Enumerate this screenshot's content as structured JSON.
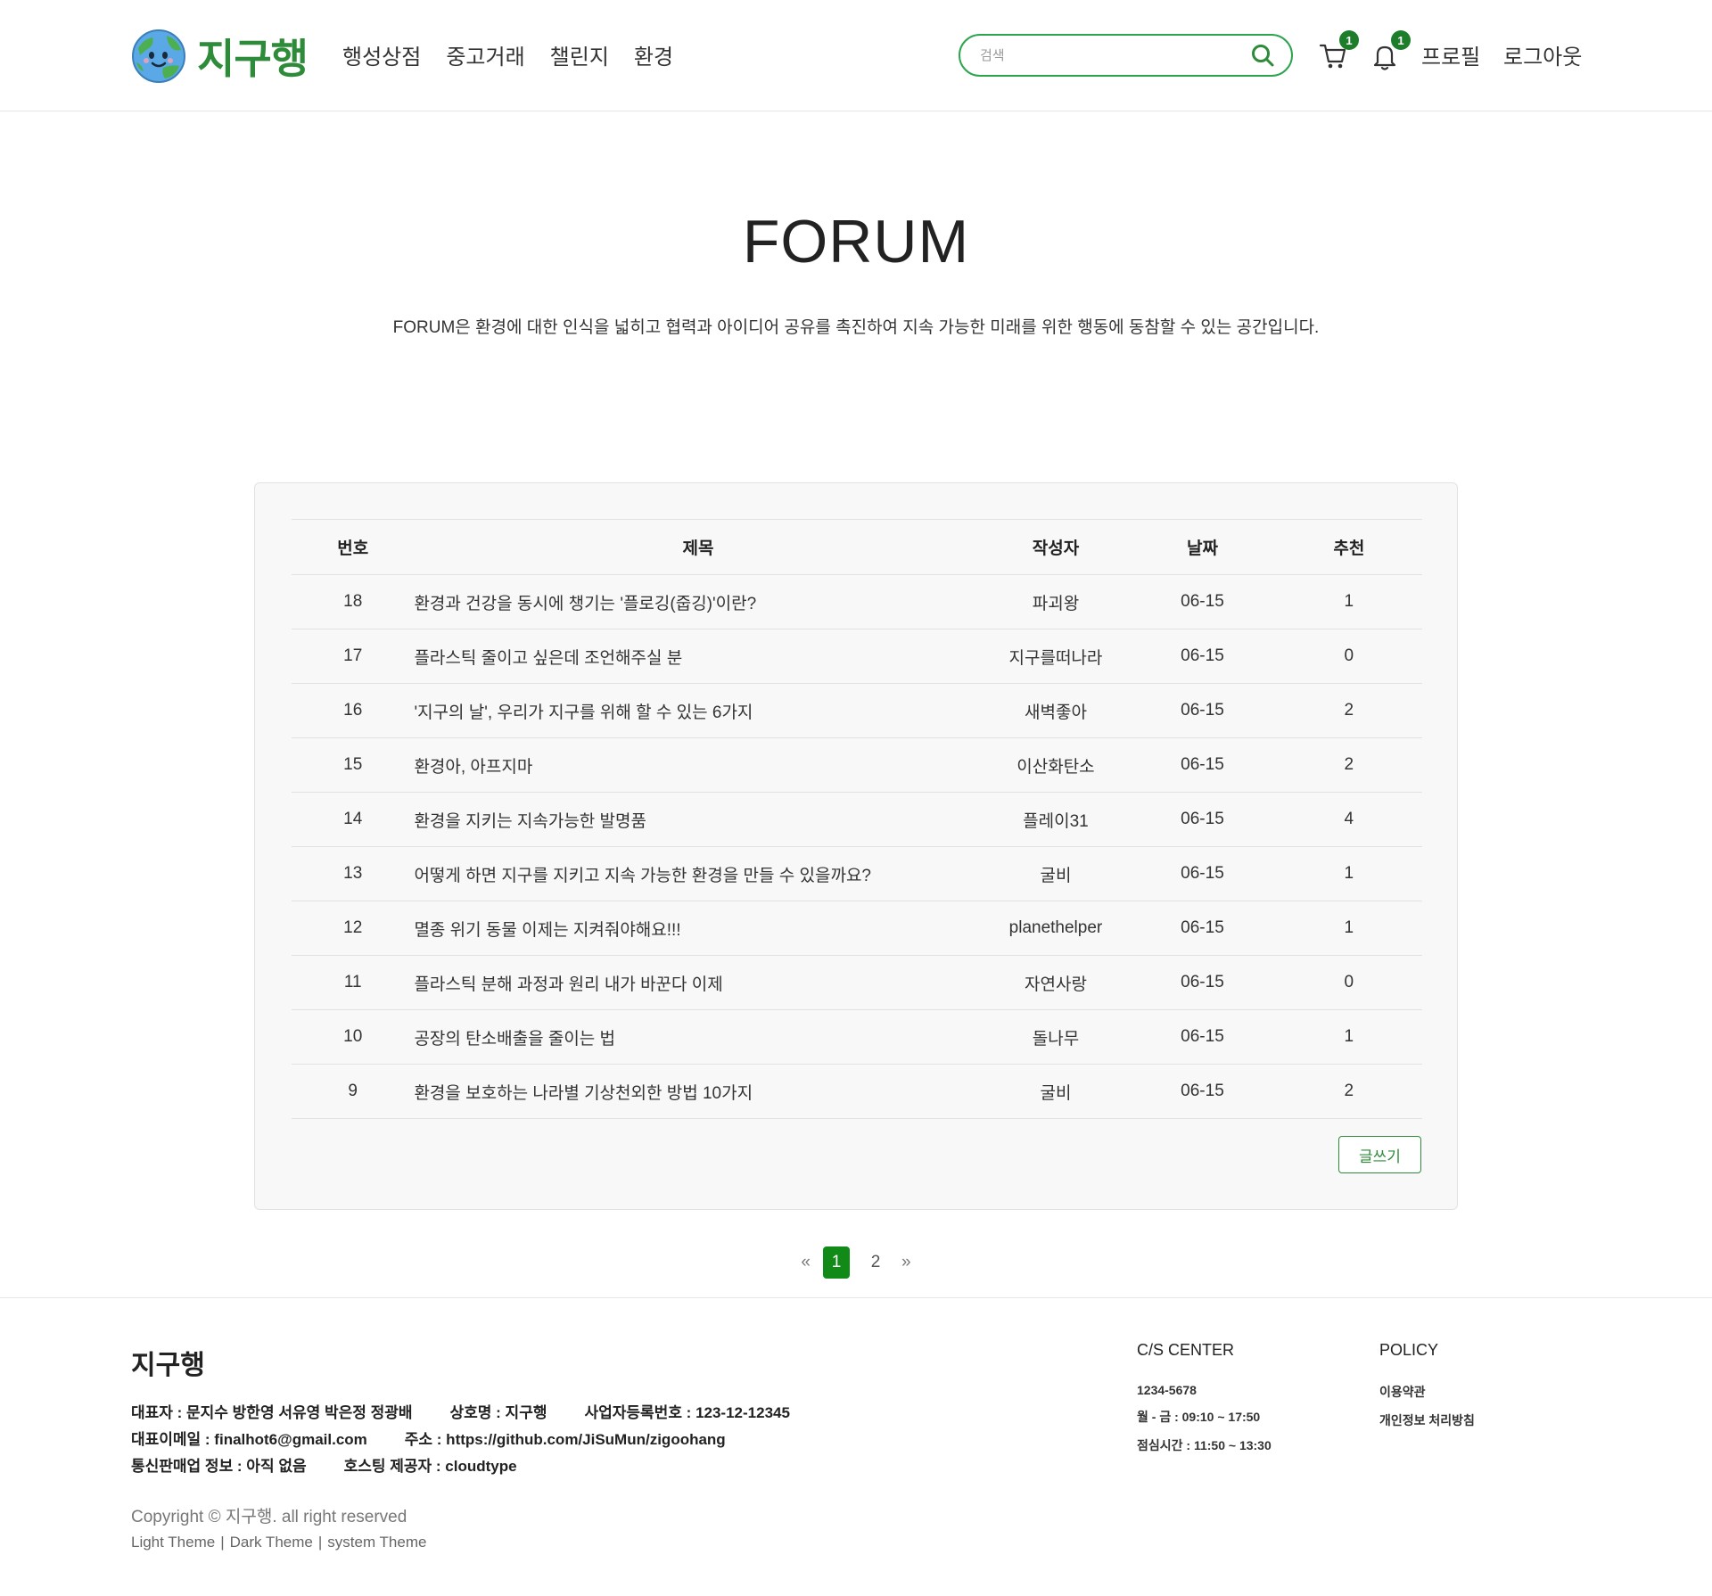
{
  "header": {
    "logo_text": "지구행",
    "nav": [
      "행성상점",
      "중고거래",
      "챌린지",
      "환경"
    ],
    "search_placeholder": "검색",
    "cart_count": "1",
    "notification_count": "1",
    "profile_label": "프로필",
    "logout_label": "로그아웃"
  },
  "hero": {
    "title": "FORUM",
    "description": "FORUM은 환경에 대한 인식을 넓히고 협력과 아이디어 공유를 촉진하여 지속 가능한 미래를 위한 행동에 동참할 수 있는 공간입니다."
  },
  "table": {
    "headers": {
      "num": "번호",
      "title": "제목",
      "author": "작성자",
      "date": "날짜",
      "recommend": "추천"
    },
    "rows": [
      {
        "num": "18",
        "title": "환경과 건강을 동시에 챙기는 '플로깅(줍깅)'이란?",
        "author": "파괴왕",
        "date": "06-15",
        "recommend": "1"
      },
      {
        "num": "17",
        "title": "플라스틱 줄이고 싶은데 조언해주실 분",
        "author": "지구를떠나라",
        "date": "06-15",
        "recommend": "0"
      },
      {
        "num": "16",
        "title": "'지구의 날', 우리가 지구를 위해 할 수 있는 6가지",
        "author": "새벽좋아",
        "date": "06-15",
        "recommend": "2"
      },
      {
        "num": "15",
        "title": "환경아, 아프지마",
        "author": "이산화탄소",
        "date": "06-15",
        "recommend": "2"
      },
      {
        "num": "14",
        "title": "환경을 지키는 지속가능한 발명품",
        "author": "플레이31",
        "date": "06-15",
        "recommend": "4"
      },
      {
        "num": "13",
        "title": "어떻게 하면 지구를 지키고 지속 가능한 환경을 만들 수 있을까요?",
        "author": "굴비",
        "date": "06-15",
        "recommend": "1"
      },
      {
        "num": "12",
        "title": "멸종 위기 동물 이제는 지켜줘야해요!!!",
        "author": "planethelper",
        "date": "06-15",
        "recommend": "1"
      },
      {
        "num": "11",
        "title": "플라스틱 분해 과정과 원리 내가 바꾼다 이제",
        "author": "자연사랑",
        "date": "06-15",
        "recommend": "0"
      },
      {
        "num": "10",
        "title": "공장의 탄소배출을 줄이는 법",
        "author": "돌나무",
        "date": "06-15",
        "recommend": "1"
      },
      {
        "num": "9",
        "title": "환경을 보호하는 나라별 기상천외한 방법 10가지",
        "author": "굴비",
        "date": "06-15",
        "recommend": "2"
      }
    ],
    "write_button": "글쓰기"
  },
  "pagination": {
    "prev": "«",
    "pages": [
      "1",
      "2"
    ],
    "active_page": "1",
    "next": "»"
  },
  "footer": {
    "brand": "지구행",
    "info_line1": [
      "대표자 : 문지수 방한영 서유영 박은정 정광배",
      "상호명 : 지구행",
      "사업자등록번호 : 123-12-12345"
    ],
    "info_line2": [
      "대표이메일 : finalhot6@gmail.com",
      "주소 : https://github.com/JiSuMun/zigoohang"
    ],
    "info_line3": [
      "통신판매업 정보 : 아직 없음",
      "호스팅 제공자 : cloudtype"
    ],
    "copyright": "Copyright © 지구행. all right reserved",
    "themes": [
      "Light Theme",
      "Dark Theme",
      "system Theme"
    ],
    "theme_separator": "|",
    "cs_title": "C/S CENTER",
    "cs_items": [
      "1234-5678",
      "월 - 금 : 09:10 ~ 17:50",
      "점심시간 : 11:50 ~ 13:30"
    ],
    "policy_title": "POLICY",
    "policy_items": [
      "이용약관",
      "개인정보 처리방침"
    ]
  },
  "colors": {
    "accent": "#2e8b3a",
    "badge": "#1e7d2b",
    "active_page": "#128a17",
    "search_border": "#2ea44f"
  }
}
